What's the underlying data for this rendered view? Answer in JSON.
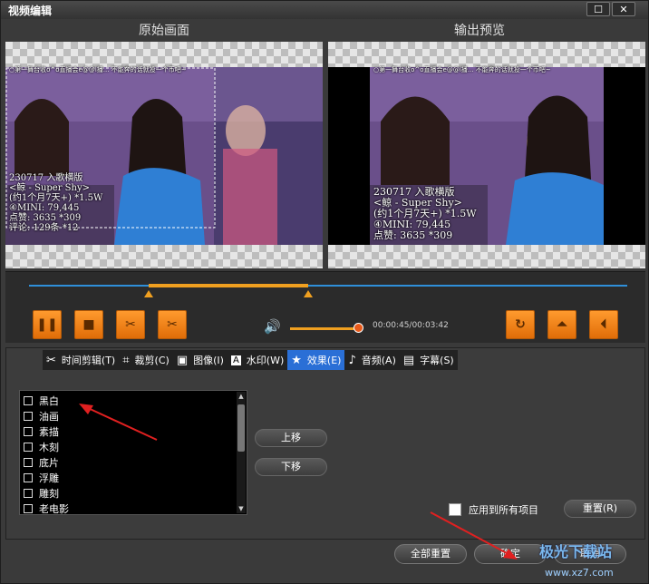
{
  "window": {
    "title": "视频编辑",
    "maximize_glyph": "☐",
    "close_glyph": "✕"
  },
  "preview": {
    "original_label": "原始画面",
    "output_label": "输出预览",
    "ticker": "○第一舞台收o^o直播会e@@l播... 不能奔的话就投一个币吧~",
    "overlay_lines": [
      "230717 入歌横版",
      "<鲸 - Super Shy>",
      "(约1个月7天+) *1.5W",
      "④MINI: 79,445",
      "点赞: 3635 *309"
    ],
    "original_extra_line": "评论: 129条 *12"
  },
  "controls": {
    "time_display": "00:00:45/00:03:42",
    "trim_start_fraction": 0.2,
    "trim_end_fraction": 0.467,
    "volume_fraction": 0.95,
    "buttons": [
      {
        "name": "pause-button",
        "glyph": "❚❚"
      },
      {
        "name": "stop-button",
        "glyph": "■"
      },
      {
        "name": "cut-button",
        "glyph": "✂"
      },
      {
        "name": "split-button",
        "glyph": "✂"
      }
    ],
    "right_buttons": [
      {
        "name": "rotate-button",
        "glyph": "↻"
      },
      {
        "name": "flip-vertical-button",
        "glyph": "⏶"
      },
      {
        "name": "flip-horizontal-button",
        "glyph": "⏴"
      }
    ]
  },
  "tabs": [
    {
      "name": "tab-trim",
      "icon": "scissors-icon",
      "glyph": "✂",
      "label": "时间剪辑(T)"
    },
    {
      "name": "tab-crop",
      "icon": "crop-icon",
      "glyph": "⌗",
      "label": "裁剪(C)"
    },
    {
      "name": "tab-image",
      "icon": "image-icon",
      "glyph": "▣",
      "label": "图像(I)"
    },
    {
      "name": "tab-watermark",
      "icon": "watermark-icon",
      "glyph": "A",
      "label": "水印(W)"
    },
    {
      "name": "tab-effects",
      "icon": "star-icon",
      "glyph": "★",
      "label": "效果(E)",
      "active": true
    },
    {
      "name": "tab-audio",
      "icon": "music-icon",
      "glyph": "♪",
      "label": "音频(A)"
    },
    {
      "name": "tab-subtitle",
      "icon": "subtitle-icon",
      "glyph": "▤",
      "label": "字幕(S)"
    }
  ],
  "effects": [
    "黑白",
    "油画",
    "素描",
    "木刻",
    "底片",
    "浮雕",
    "雕刻",
    "老电影"
  ],
  "buttons": {
    "move_up": "上移",
    "move_down": "下移",
    "apply_all": "应用到所有项目",
    "reset": "重置(R)",
    "reset_all": "全部重置",
    "ok": "确定",
    "cancel": "取消"
  },
  "watermark_text": "极光下载站",
  "watermark_url": "www.xz7.com",
  "colors": {
    "accent": "#2a6fd6",
    "orange": "#f0a020",
    "arrow": "#e02020"
  }
}
